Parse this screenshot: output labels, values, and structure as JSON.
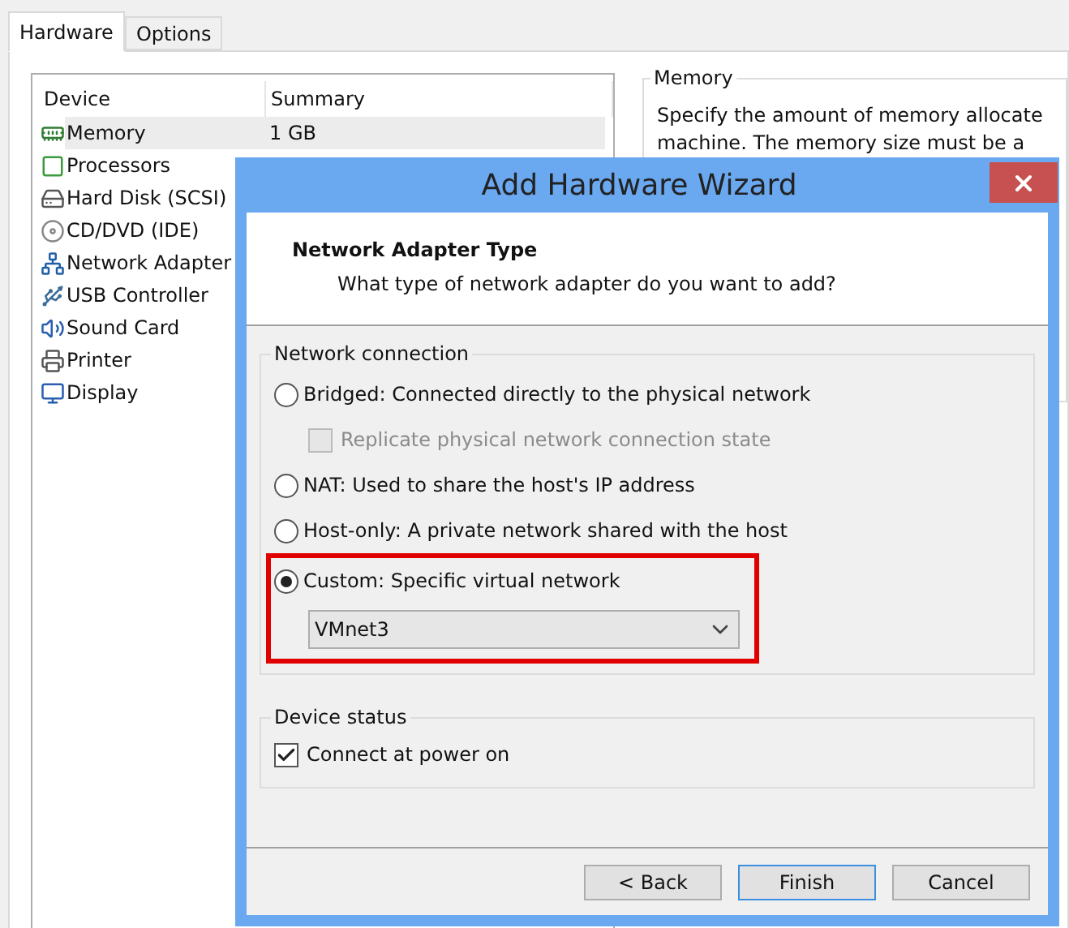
{
  "tabs": [
    {
      "label": "Hardware",
      "selected": true
    },
    {
      "label": "Options",
      "selected": false
    }
  ],
  "device_table": {
    "columns": [
      "Device",
      "Summary"
    ],
    "rows": [
      {
        "device": "Memory",
        "summary": "1 GB",
        "selected": true
      },
      {
        "device": "Processors",
        "selected": false
      },
      {
        "device": "Hard Disk (SCSI)",
        "selected": false
      },
      {
        "device": "CD/DVD (IDE)",
        "selected": false
      },
      {
        "device": "Network Adapter",
        "selected": false
      },
      {
        "device": "USB Controller",
        "selected": false
      },
      {
        "device": "Sound Card",
        "selected": false
      },
      {
        "device": "Printer",
        "selected": false
      },
      {
        "device": "Display",
        "selected": false
      }
    ]
  },
  "memory_panel": {
    "title": "Memory",
    "lines": [
      "Specify the amount of memory allocate",
      "machine. The memory size must be a"
    ]
  },
  "dialog": {
    "title": "Add Hardware Wizard",
    "heading": "Network Adapter Type",
    "subheading": "What type of network adapter do you want to add?",
    "network_connection": {
      "title": "Network connection",
      "items": [
        {
          "kind": "radio",
          "label": "Bridged: Connected directly to the physical network",
          "selected": false,
          "highlighted": false
        },
        {
          "kind": "checkbox",
          "label": "Replicate physical network connection state",
          "checked": false,
          "disabled": true,
          "highlighted": false
        },
        {
          "kind": "radio",
          "label": "NAT: Used to share the host's IP address",
          "selected": false,
          "highlighted": false
        },
        {
          "kind": "radio",
          "label": "Host-only: A private network shared with the host",
          "selected": false,
          "highlighted": false
        },
        {
          "kind": "radio",
          "label": "Custom: Specific virtual network",
          "selected": true,
          "highlighted": true
        },
        {
          "kind": "select",
          "value": "VMnet3",
          "highlighted": true
        }
      ]
    },
    "device_status": {
      "title": "Device status",
      "items": [
        {
          "kind": "checkbox",
          "label": "Connect at power on",
          "checked": true,
          "disabled": false
        }
      ]
    },
    "buttons": [
      {
        "label": "< Back",
        "default": false
      },
      {
        "label": "Finish",
        "default": true
      },
      {
        "label": "Cancel",
        "default": false
      }
    ]
  }
}
